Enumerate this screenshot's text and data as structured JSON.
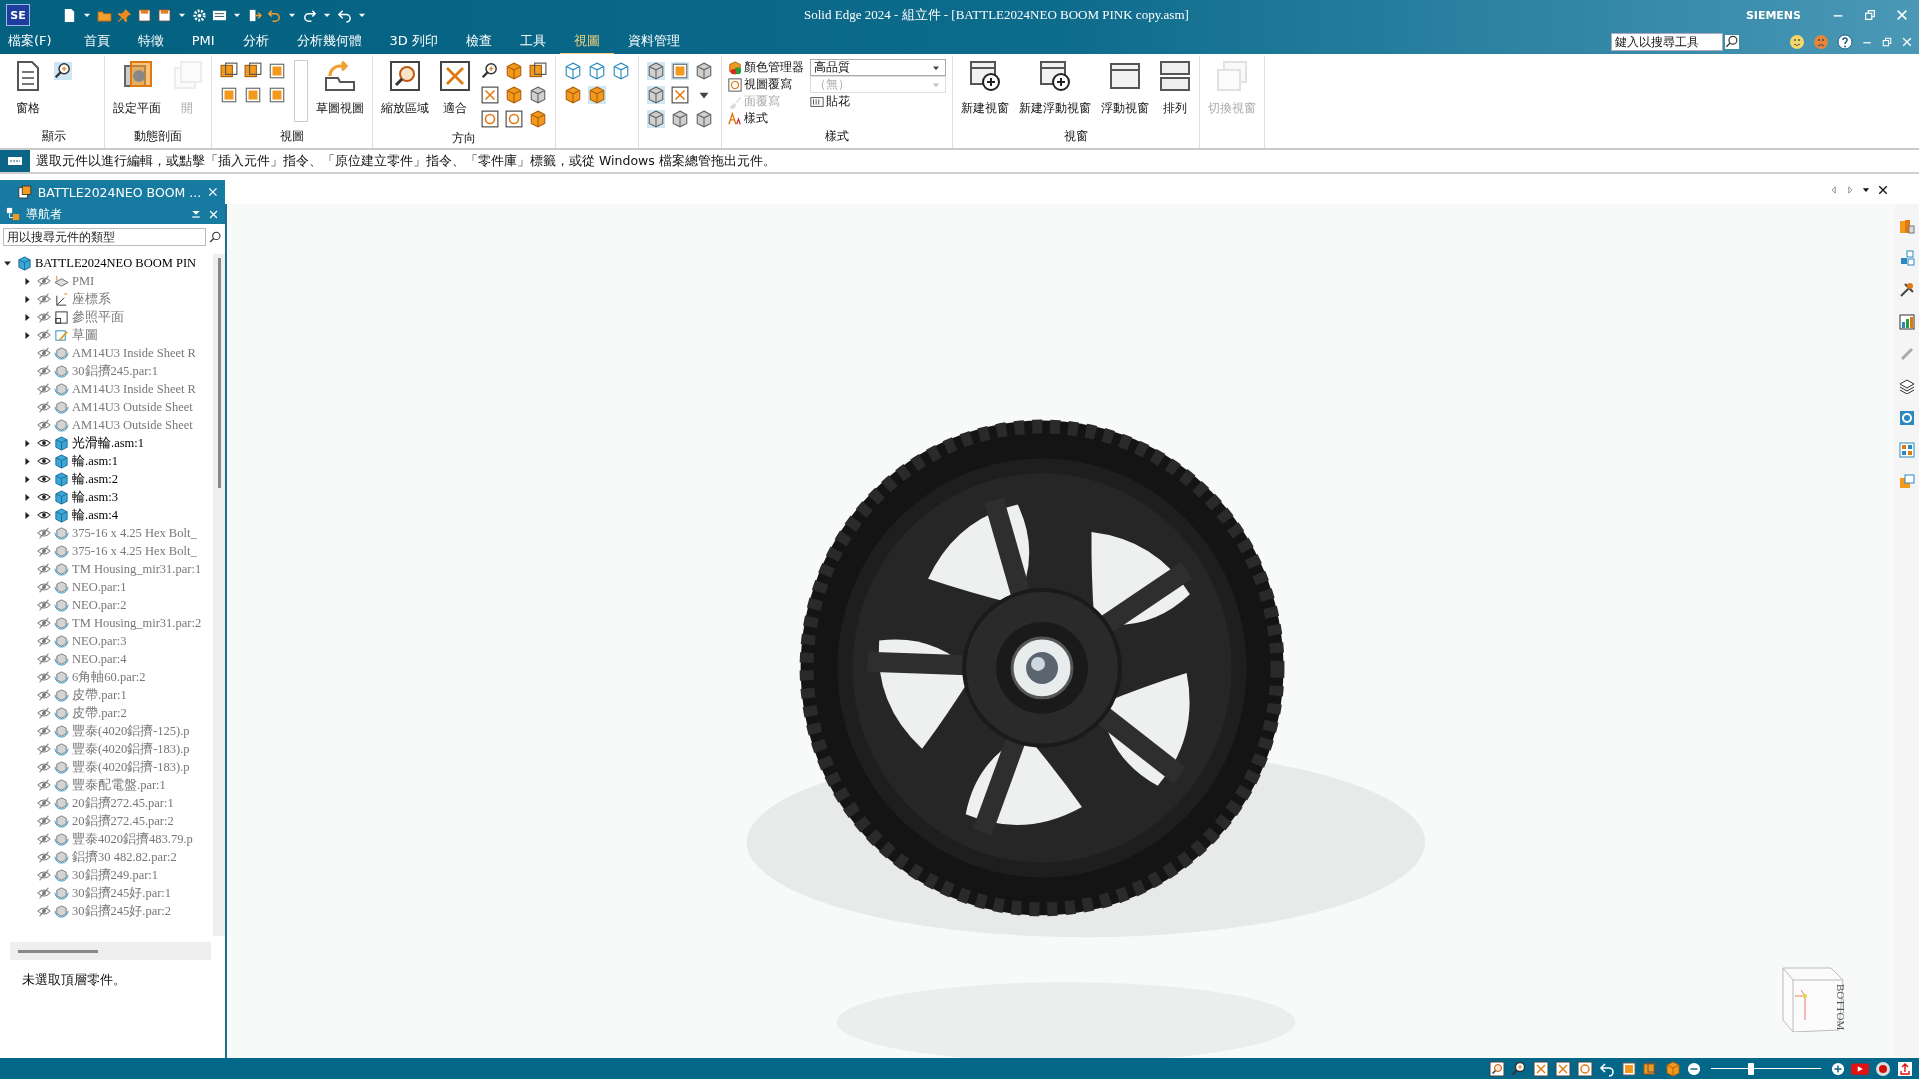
{
  "title_bar": {
    "app_logo": "SE",
    "title": "Solid Edge 2024 - 組立件 - [BATTLE2024NEO BOOM PINK copy.asm]",
    "brand": "SIEMENS"
  },
  "menu": {
    "tabs": [
      {
        "label": "檔案(F)",
        "selected": false
      },
      {
        "label": "首頁",
        "selected": false
      },
      {
        "label": "特徵",
        "selected": false
      },
      {
        "label": "PMI",
        "selected": false
      },
      {
        "label": "分析",
        "selected": false
      },
      {
        "label": "分析幾何體",
        "selected": false
      },
      {
        "label": "3D 列印",
        "selected": false
      },
      {
        "label": "檢查",
        "selected": false
      },
      {
        "label": "工具",
        "selected": false
      },
      {
        "label": "視圖",
        "selected": true
      },
      {
        "label": "資料管理",
        "selected": false
      }
    ],
    "search": {
      "placeholder": "鍵入以搜尋工具"
    }
  },
  "ribbon": {
    "groups": [
      {
        "label": "顯示",
        "items": [
          {
            "kind": "large",
            "label": "窗格",
            "disabled": false
          },
          {
            "kind": "icons"
          }
        ]
      },
      {
        "label": "動態剖面",
        "items": [
          {
            "kind": "large",
            "label": "設定平面",
            "disabled": false
          },
          {
            "kind": "large",
            "label": "開",
            "disabled": true
          }
        ]
      },
      {
        "label": "視圖",
        "items": [
          {
            "kind": "icons"
          },
          {
            "kind": "large",
            "label": "草圖視圖",
            "disabled": false
          }
        ]
      },
      {
        "label": "方向",
        "items": [
          {
            "kind": "large",
            "label": "縮放區域",
            "disabled": false
          },
          {
            "kind": "large",
            "label": "適合",
            "disabled": false
          },
          {
            "kind": "icons"
          }
        ]
      },
      {
        "items": [
          {
            "kind": "icons"
          }
        ]
      },
      {
        "items": [
          {
            "kind": "icons"
          }
        ]
      },
      {
        "label": "樣式",
        "items": [
          {
            "kind": "small",
            "label": "顏色管理器",
            "disabled": false
          },
          {
            "kind": "small",
            "label": "視圖覆寫",
            "disabled": false
          },
          {
            "kind": "small",
            "label": "面覆寫",
            "disabled": true
          },
          {
            "kind": "small",
            "label": "樣式",
            "disabled": false
          },
          {
            "kind": "combo",
            "label": "高品質",
            "disabled": false
          },
          {
            "kind": "combo",
            "label": "（無）",
            "disabled": true
          },
          {
            "kind": "small",
            "label": "貼花",
            "disabled": false
          }
        ]
      },
      {
        "label": "視窗",
        "items": [
          {
            "kind": "large",
            "label": "新建視窗",
            "disabled": false
          },
          {
            "kind": "large",
            "label": "新建浮動視窗",
            "disabled": false
          },
          {
            "kind": "large",
            "label": "浮動視窗",
            "disabled": false
          },
          {
            "kind": "large",
            "label": "排列",
            "disabled": false
          }
        ]
      },
      {
        "items": [
          {
            "kind": "large",
            "label": "切換視窗",
            "disabled": true
          }
        ]
      }
    ]
  },
  "prompt_bar": {
    "text": "選取元件以進行編輯，或點擊「插入元件」指令、「原位建立零件」指令、「零件庫」標籤，或從 Windows 檔案總管拖出元件。"
  },
  "document_tab": {
    "label": "BATTLE2024NEO BOOM ..."
  },
  "navigator": {
    "title": "導航者",
    "search": {
      "placeholder": "用以搜尋元件的類型"
    },
    "tree": [
      {
        "label": "BATTLE2024NEO BOOM PIN",
        "kind": "assembly",
        "expanded": true,
        "children": [
          {
            "label": "PMI",
            "kind": "pmi",
            "expanded": false,
            "visible": false
          },
          {
            "label": "座標系",
            "kind": "coordinate-system",
            "expanded": false,
            "visible": false
          },
          {
            "label": "參照平面",
            "kind": "reference-plane",
            "expanded": false,
            "visible": false
          },
          {
            "label": "草圖",
            "kind": "sketch",
            "expanded": false,
            "visible": false
          },
          {
            "label": "AM14U3 Inside Sheet R",
            "kind": "part",
            "visible": false
          },
          {
            "label": "30鋁擠245.par:1",
            "kind": "part",
            "visible": false
          },
          {
            "label": "AM14U3 Inside Sheet R",
            "kind": "part",
            "visible": false
          },
          {
            "label": "AM14U3 Outside Sheet",
            "kind": "part",
            "visible": false
          },
          {
            "label": "AM14U3 Outside Sheet",
            "kind": "part",
            "visible": false
          },
          {
            "label": "光滑輪.asm:1",
            "kind": "assembly",
            "expanded": false,
            "visible": true
          },
          {
            "label": "輪.asm:1",
            "kind": "assembly",
            "expanded": false,
            "visible": true
          },
          {
            "label": "輪.asm:2",
            "kind": "assembly",
            "expanded": false,
            "visible": true
          },
          {
            "label": "輪.asm:3",
            "kind": "assembly",
            "expanded": false,
            "visible": true
          },
          {
            "label": "輪.asm:4",
            "kind": "assembly",
            "expanded": false,
            "visible": true
          },
          {
            "label": "375-16 x 4.25 Hex Bolt_",
            "kind": "part",
            "visible": false
          },
          {
            "label": "375-16 x 4.25 Hex Bolt_",
            "kind": "part",
            "visible": false
          },
          {
            "label": "TM Housing_mir31.par:1",
            "kind": "part",
            "visible": false
          },
          {
            "label": "NEO.par:1",
            "kind": "part",
            "visible": false
          },
          {
            "label": "NEO.par:2",
            "kind": "part",
            "visible": false
          },
          {
            "label": "TM Housing_mir31.par:2",
            "kind": "part",
            "visible": false
          },
          {
            "label": "NEO.par:3",
            "kind": "part",
            "visible": false
          },
          {
            "label": "NEO.par:4",
            "kind": "part",
            "visible": false
          },
          {
            "label": "6角軸60.par:2",
            "kind": "part",
            "visible": false
          },
          {
            "label": "皮帶.par:1",
            "kind": "part",
            "visible": false
          },
          {
            "label": "皮帶.par:2",
            "kind": "part",
            "visible": false
          },
          {
            "label": "豐泰(4020鋁擠-125).p",
            "kind": "part",
            "visible": false
          },
          {
            "label": "豐泰(4020鋁擠-183).p",
            "kind": "part",
            "visible": false
          },
          {
            "label": "豐泰(4020鋁擠-183).p",
            "kind": "part",
            "visible": false
          },
          {
            "label": "豐泰配電盤.par:1",
            "kind": "part",
            "visible": false
          },
          {
            "label": "20鋁擠272.45.par:1",
            "kind": "part",
            "visible": false
          },
          {
            "label": "20鋁擠272.45.par:2",
            "kind": "part",
            "visible": false
          },
          {
            "label": "豐泰4020鋁擠483.79.p",
            "kind": "part",
            "visible": false
          },
          {
            "label": "鋁擠30 482.82.par:2",
            "kind": "part",
            "visible": false
          },
          {
            "label": "30鋁擠249.par:1",
            "kind": "part",
            "visible": false
          },
          {
            "label": "30鋁擠245好.par:1",
            "kind": "part",
            "visible": false
          },
          {
            "label": "30鋁擠245好.par:2",
            "kind": "part",
            "visible": false
          }
        ]
      }
    ],
    "message": "未選取頂層零件。"
  },
  "view_cube": {
    "label": "BOTTOM"
  },
  "status_bar": {
    "zoom_slider": {
      "level": 0.36
    }
  }
}
